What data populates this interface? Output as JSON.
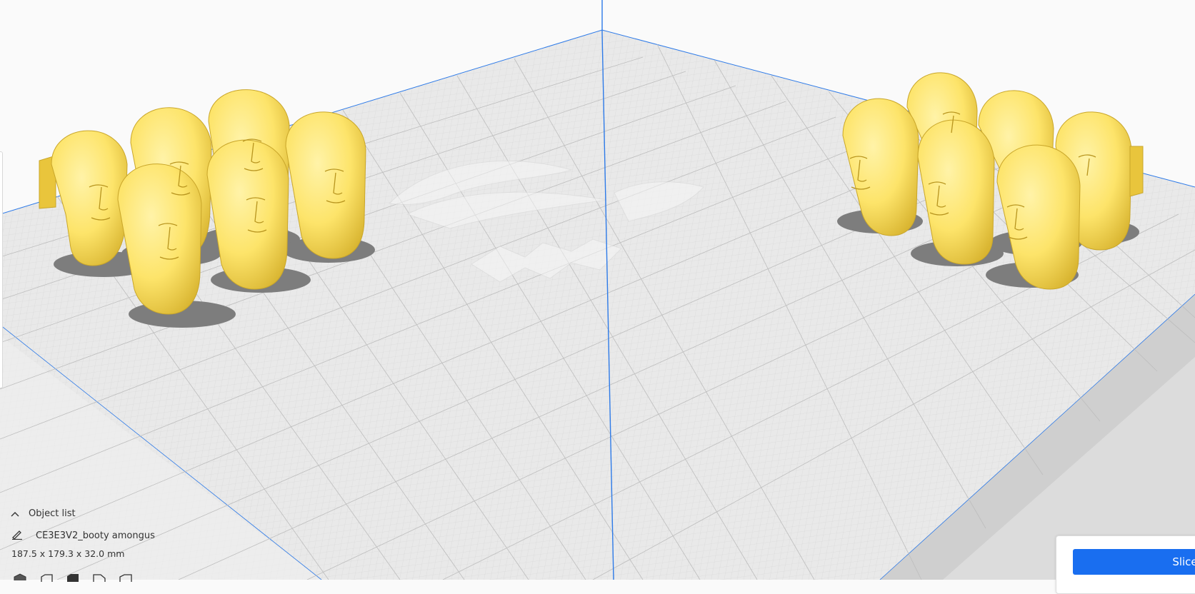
{
  "object_list": {
    "label": "Object list",
    "toggle_icon": "chevron-up-icon",
    "edit_icon": "pencil-icon",
    "object_name": "CE3E3V2_booty amongus",
    "dimensions": "187.5 x 179.3 x 32.0 mm"
  },
  "view_buttons": [
    "view-3d-icon",
    "view-front-icon",
    "view-top-icon",
    "view-left-icon",
    "view-right-icon"
  ],
  "slice": {
    "label": "Slice"
  },
  "colors": {
    "model": "#fde46a",
    "model_shade": "#e9c53c",
    "build_plate": "#e4e4e4",
    "axis_blue": "#2d7ae8",
    "slice_button": "#196ef0"
  }
}
